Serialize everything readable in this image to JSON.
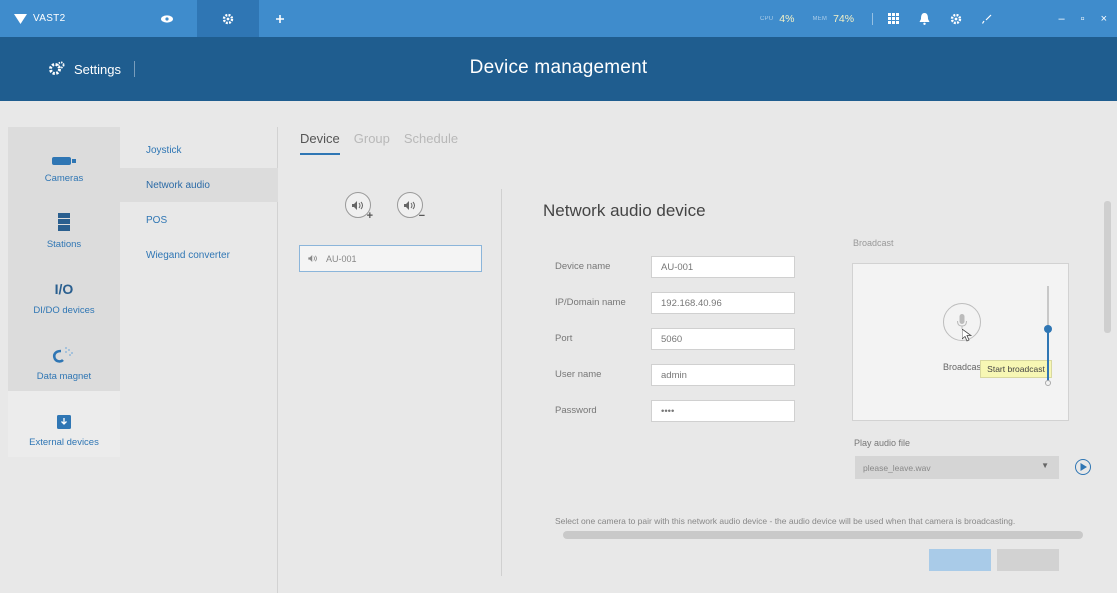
{
  "titlebar": {
    "app_name": "VAST2",
    "tabs": [
      {
        "icon": "eye-icon",
        "active": false
      },
      {
        "icon": "gear-icon",
        "active": true
      },
      {
        "icon": "plus-icon",
        "active": false
      }
    ],
    "stats": {
      "cpu_caption": "CPU",
      "cpu_value": "4%",
      "mem_caption": "MEM",
      "mem_value": "74%"
    },
    "icons": [
      "grid-icon",
      "bell-icon",
      "gear-icon",
      "wrench-icon"
    ],
    "window_controls": {
      "minimize": "–",
      "maximize": "▫",
      "close": "×"
    }
  },
  "header": {
    "settings_label": "Settings",
    "page_title": "Device management"
  },
  "leftnav": {
    "items": [
      {
        "label": "Cameras",
        "icon": "camera-icon"
      },
      {
        "label": "Stations",
        "icon": "server-icon"
      },
      {
        "label": "DI/DO devices",
        "icon": "io-icon",
        "icon_text": "I/O"
      },
      {
        "label": "Data magnet",
        "icon": "data-magnet-icon"
      },
      {
        "label": "External devices",
        "icon": "external-device-icon",
        "active": true
      }
    ]
  },
  "subnav": {
    "items": [
      {
        "label": "Joystick"
      },
      {
        "label": "Network audio",
        "active": true
      },
      {
        "label": "POS"
      },
      {
        "label": "Wiegand converter"
      }
    ]
  },
  "tabs": {
    "device": "Device",
    "group": "Group",
    "schedule": "Schedule"
  },
  "toolbar": {
    "add_badge": "+",
    "remove_badge": "−"
  },
  "device_list": [
    {
      "name": "AU-001"
    }
  ],
  "form": {
    "title": "Network audio device",
    "device_name_label": "Device name",
    "device_name_value": "AU-001",
    "ip_label": "IP/Domain name",
    "ip_value": "192.168.40.96",
    "port_label": "Port",
    "port_value": "5060",
    "user_label": "User name",
    "user_value": "admin",
    "password_label": "Password",
    "password_value": "••••"
  },
  "broadcast": {
    "section_label": "Broadcast",
    "button_label": "Broadcast",
    "tooltip": "Start broadcast"
  },
  "play_audio": {
    "label": "Play audio file",
    "selected": "please_leave.wav"
  },
  "footer": {
    "hint": "Select one camera to pair with this network audio device - the audio device will be used when that camera is broadcasting."
  },
  "colors": {
    "titlebar": "#3f8ccc",
    "header": "#1f5d8f",
    "accent": "#2f76b4",
    "tooltip": "#f7f7b4"
  }
}
